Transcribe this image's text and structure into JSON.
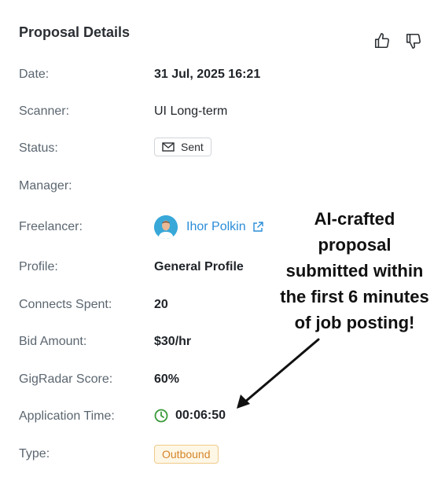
{
  "header": {
    "title": "Proposal Details",
    "thumbs_up_icon": "thumbs-up-icon",
    "thumbs_down_icon": "thumbs-down-icon"
  },
  "fields": {
    "date": {
      "label": "Date:",
      "value": "31 Jul, 2025 16:21"
    },
    "scanner": {
      "label": "Scanner:",
      "value": "UI Long-term"
    },
    "status": {
      "label": "Status:",
      "value": "Sent",
      "icon": "envelope-icon"
    },
    "manager": {
      "label": "Manager:",
      "value": ""
    },
    "freelancer": {
      "label": "Freelancer:",
      "value": "Ihor Polkin",
      "icon": "external-link-icon"
    },
    "profile": {
      "label": "Profile:",
      "value": "General Profile"
    },
    "connects": {
      "label": "Connects Spent:",
      "value": "20"
    },
    "bid": {
      "label": "Bid Amount:",
      "value": "$30/hr"
    },
    "score": {
      "label": "GigRadar Score:",
      "value": "60%"
    },
    "application_time": {
      "label": "Application Time:",
      "value": "00:06:50",
      "icon": "clock-icon"
    },
    "type": {
      "label": "Type:",
      "value": "Outbound"
    }
  },
  "annotation": {
    "lines": [
      "AI-crafted",
      "proposal",
      "submitted within",
      "the first 6 minutes",
      "of job posting!"
    ]
  },
  "colors": {
    "link": "#2a8dd8",
    "clock": "#3a9a3a",
    "outbound_text": "#d4852a",
    "outbound_bg": "#fff7e6",
    "outbound_border": "#f0c98a"
  }
}
